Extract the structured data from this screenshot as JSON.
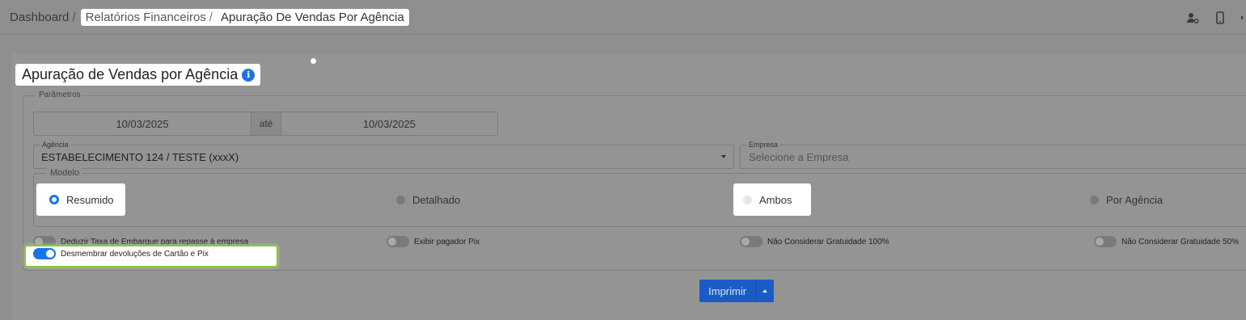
{
  "breadcrumb": {
    "home": "Dashboard",
    "section": "Relatórios Financeiros",
    "current": "Apuração De Vendas Por Agência"
  },
  "page": {
    "title": "Apuração de Vendas por Agência"
  },
  "parametros": {
    "legend": "Parâmetros",
    "date_from": "10/03/2025",
    "date_sep": "até",
    "date_to": "10/03/2025",
    "agencia": {
      "label": "Agência",
      "value": "ESTABELECIMENTO 124 / TESTE (xxxX)"
    },
    "empresa": {
      "label": "Empresa",
      "placeholder": "Selecione a Empresa"
    }
  },
  "modelo": {
    "legend": "Modelo",
    "options": [
      {
        "label": "Resumido",
        "selected": true
      },
      {
        "label": "Detalhado",
        "selected": false
      },
      {
        "label": "Ambos",
        "selected": false
      },
      {
        "label": "Por Agência",
        "selected": false
      }
    ]
  },
  "toggles": [
    {
      "label": "Deduzir Taxa de Embarque para repasse à empresa",
      "on": false
    },
    {
      "label": "Exibir pagador Pix",
      "on": false
    },
    {
      "label": "Não Considerar Gratuidade 100%",
      "on": false
    },
    {
      "label": "Não Considerar Gratuidade 50%",
      "on": false
    },
    {
      "label": "Desmembrar devoluções de Cartão e Pix",
      "on": true
    }
  ],
  "actions": {
    "print": "Imprimir"
  },
  "colors": {
    "primary": "#1a73e8",
    "highlight_border": "#8bc34a",
    "overlay": "#8f8f8f"
  },
  "icons": [
    "user-gear-icon",
    "mobile-icon",
    "settings-icon"
  ]
}
